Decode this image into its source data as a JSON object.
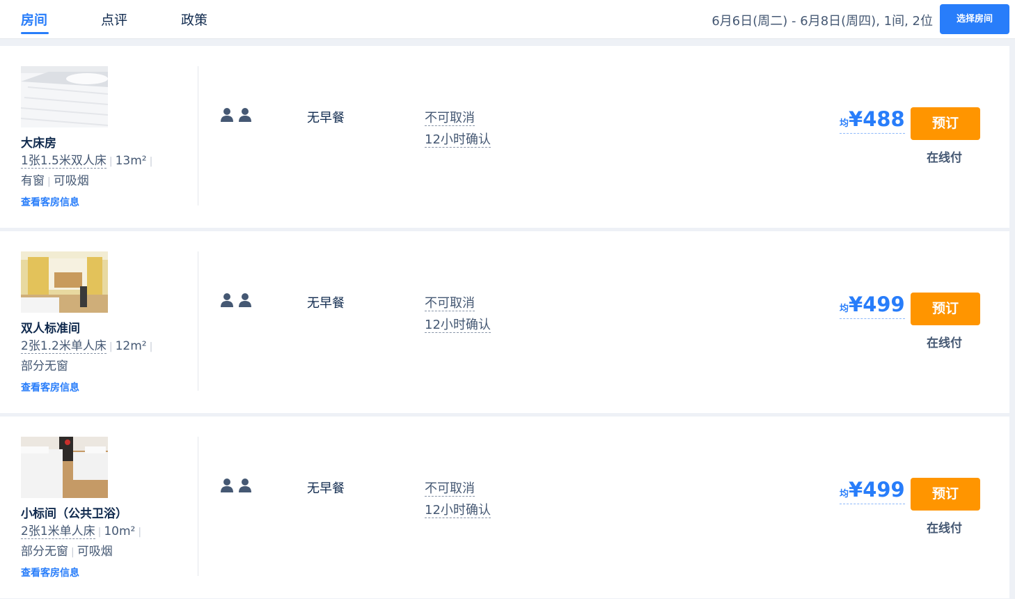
{
  "tabs": [
    {
      "label": "房间"
    },
    {
      "label": "点评"
    },
    {
      "label": "政策"
    }
  ],
  "header": {
    "date_summary": "6月6日(周二) - 6月8日(周四), 1间, 2位",
    "select_room_label": "选择房间"
  },
  "colors": {
    "accent": "#287dfa",
    "book_button": "#ff9500",
    "text_dark": "#0f294d"
  },
  "rooms": [
    {
      "name": "大床房",
      "bed": "1张1.5米双人床",
      "area": "13m²",
      "window": "有窗",
      "smoking": "可吸烟",
      "info_link": "查看客房信息",
      "guests_icon": "person-icon",
      "breakfast": "无早餐",
      "cancel_policy": "不可取消",
      "confirm_time": "12小时确认",
      "price_prefix": "均",
      "price": "¥488",
      "book_label": "预订",
      "pay_type": "在线付"
    },
    {
      "name": "双人标准间",
      "bed": "2张1.2米单人床",
      "area": "12m²",
      "window": "部分无窗",
      "info_link": "查看客房信息",
      "guests_icon": "person-icon",
      "breakfast": "无早餐",
      "cancel_policy": "不可取消",
      "confirm_time": "12小时确认",
      "price_prefix": "均",
      "price": "¥499",
      "book_label": "预订",
      "pay_type": "在线付"
    },
    {
      "name": "小标间（公共卫浴）",
      "bed": "2张1米单人床",
      "area": "10m²",
      "window": "部分无窗",
      "smoking": "可吸烟",
      "info_link": "查看客房信息",
      "guests_icon": "person-icon",
      "breakfast": "无早餐",
      "cancel_policy": "不可取消",
      "confirm_time": "12小时确认",
      "price_prefix": "均",
      "price": "¥499",
      "book_label": "预订",
      "pay_type": "在线付"
    }
  ]
}
